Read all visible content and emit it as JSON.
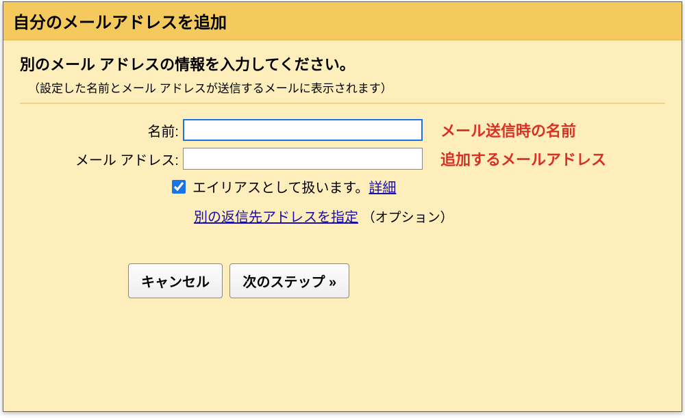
{
  "title": "自分のメールアドレスを追加",
  "instruction": "別のメール アドレスの情報を入力してください。",
  "sub_instruction": "（設定した名前とメール アドレスが送信するメールに表示されます）",
  "form": {
    "name_label": "名前:",
    "email_label": "メール アドレス:",
    "name_value": "",
    "email_value": ""
  },
  "alias": {
    "label": "エイリアスとして扱います。",
    "detail_link": "詳細",
    "checked": true
  },
  "reply": {
    "link": "別の返信先アドレスを指定",
    "option": "（オプション）"
  },
  "buttons": {
    "cancel": "キャンセル",
    "next": "次のステップ »"
  },
  "annotations": {
    "name": "メール送信時の名前",
    "email": "追加するメールアドレス"
  }
}
